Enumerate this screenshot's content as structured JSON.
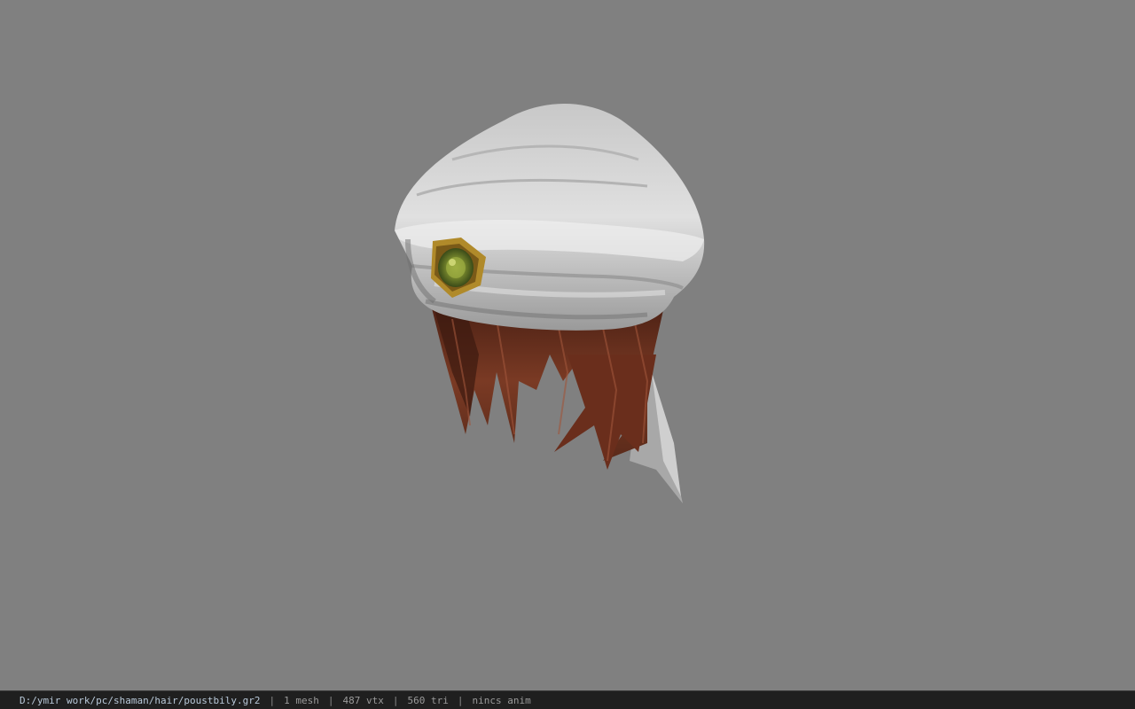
{
  "viewport": {
    "background_color": "#808080",
    "model": {
      "subject": "hair-model",
      "colors": {
        "turban": "#d4d4d4",
        "turban_shadow": "#8e8e8e",
        "hair": "#7a3a24",
        "hair_dark": "#3c1a10",
        "gem": "#8a9a3a",
        "gem_rim": "#b08a2a"
      }
    }
  },
  "statusbar": {
    "path": "D:/ymir work/pc/shaman/hair/poustbily.gr2",
    "mesh": "1 mesh",
    "vertices": "487 vtx",
    "triangles": "560 tri",
    "anim": "nincs anim",
    "separator": "|"
  }
}
